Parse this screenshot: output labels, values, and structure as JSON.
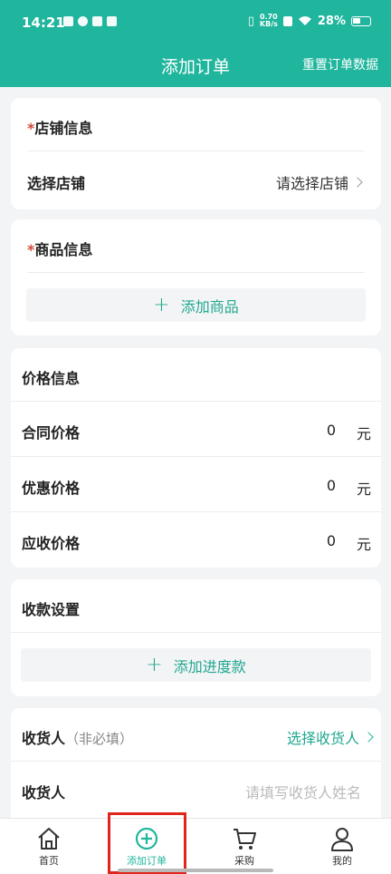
{
  "status": {
    "time": "14:21",
    "net_speed_top": "0.70",
    "net_speed_bottom": "KB/s",
    "battery": "28%"
  },
  "header": {
    "title": "添加订单",
    "reset_label": "重置订单数据"
  },
  "store": {
    "required_mark": "*",
    "title": "店铺信息",
    "select_label": "选择店铺",
    "select_placeholder": "请选择店铺"
  },
  "goods": {
    "required_mark": "*",
    "title": "商品信息",
    "add_label": "添加商品"
  },
  "price": {
    "title": "价格信息",
    "rows": [
      {
        "label": "合同价格",
        "value": "0",
        "unit": "元"
      },
      {
        "label": "优惠价格",
        "value": "0",
        "unit": "元"
      },
      {
        "label": "应收价格",
        "value": "0",
        "unit": "元"
      }
    ]
  },
  "payment": {
    "title": "收款设置",
    "add_label": "添加进度款"
  },
  "receiver": {
    "title": "收货人",
    "optional_note": "（非必填）",
    "select_label": "选择收货人",
    "name_label": "收货人",
    "name_placeholder": "请填写收货人姓名"
  },
  "tabs": [
    {
      "label": "首页",
      "icon": "home-icon"
    },
    {
      "label": "添加订单",
      "icon": "plus-circle-icon"
    },
    {
      "label": "采购",
      "icon": "cart-icon"
    },
    {
      "label": "我的",
      "icon": "user-icon"
    }
  ],
  "colors": {
    "accent": "#20b59d",
    "required": "#d24a3c",
    "highlight": "#e0261c"
  }
}
